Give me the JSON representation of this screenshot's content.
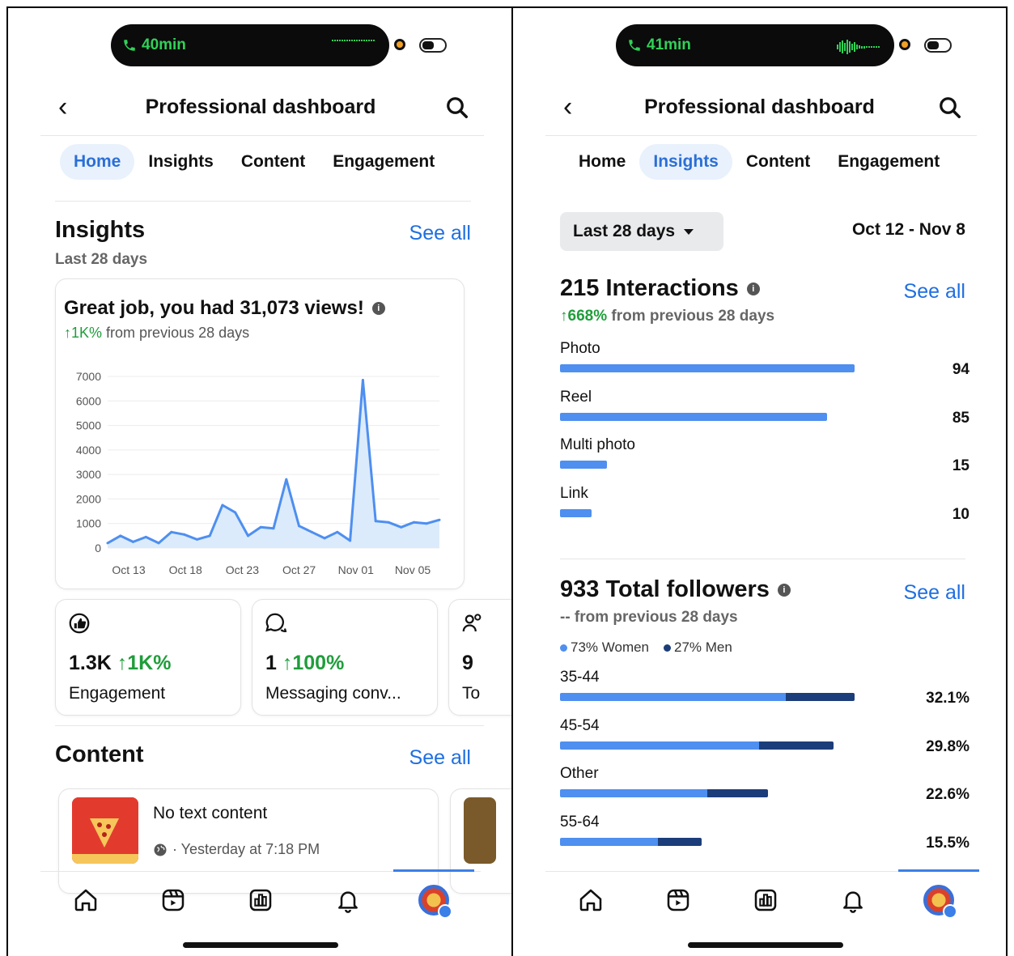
{
  "left": {
    "status": {
      "call_time": "40min"
    },
    "header": {
      "title": "Professional dashboard"
    },
    "tabs": [
      {
        "label": "Home",
        "active": true
      },
      {
        "label": "Insights",
        "active": false
      },
      {
        "label": "Content",
        "active": false
      },
      {
        "label": "Engagement",
        "active": false
      }
    ],
    "insights": {
      "title": "Insights",
      "see_all": "See all",
      "period": "Last 28 days",
      "views_headline": "Great job, you had 31,073 views!",
      "growth_value": "↑1K%",
      "growth_text": "from previous 28 days"
    },
    "chart_data": {
      "type": "area",
      "x_ticks": [
        "Oct 13",
        "Oct 18",
        "Oct 23",
        "Oct 27",
        "Nov 01",
        "Nov 05"
      ],
      "y_ticks": [
        "7000",
        "6000",
        "5000",
        "4000",
        "3000",
        "2000",
        "1000",
        "0"
      ],
      "ylim": [
        0,
        7000
      ],
      "values": [
        200,
        500,
        250,
        450,
        200,
        650,
        550,
        350,
        500,
        1750,
        1450,
        500,
        850,
        800,
        2800,
        900,
        650,
        400,
        650,
        300,
        6850,
        1100,
        1050,
        850,
        1050,
        1000,
        1150
      ],
      "color": "#4e8ff0"
    },
    "stats": [
      {
        "value": "1.3K",
        "change": "↑1K%",
        "label": "Engagement",
        "icon": "like-icon"
      },
      {
        "value": "1",
        "change": "↑100%",
        "label": "Messaging conv...",
        "icon": "message-icon"
      },
      {
        "value": "9",
        "change": "",
        "label": "To",
        "icon": "followers-icon"
      }
    ],
    "content": {
      "title": "Content",
      "see_all": "See all",
      "post_title": "No text content",
      "post_meta": "· Yesterday at 7:18 PM"
    }
  },
  "right": {
    "status": {
      "call_time": "41min"
    },
    "header": {
      "title": "Professional dashboard"
    },
    "tabs": [
      {
        "label": "Home",
        "active": false
      },
      {
        "label": "Insights",
        "active": true
      },
      {
        "label": "Content",
        "active": false
      },
      {
        "label": "Engagement",
        "active": false
      }
    ],
    "range_label": "Last 28 days",
    "date_range": "Oct 12 - Nov 8",
    "interactions": {
      "title": "215 Interactions",
      "see_all": "See all",
      "growth_value": "↑668%",
      "growth_text": "from previous 28 days",
      "rows": [
        {
          "label": "Photo",
          "value": "94",
          "fraction": 0.72
        },
        {
          "label": "Reel",
          "value": "85",
          "fraction": 0.652
        },
        {
          "label": "Multi photo",
          "value": "15",
          "fraction": 0.115
        },
        {
          "label": "Link",
          "value": "10",
          "fraction": 0.077
        }
      ]
    },
    "followers": {
      "title": "933 Total followers",
      "see_all": "See all",
      "sub": "-- from previous 28 days",
      "women": "73% Women",
      "men": "27% Men",
      "women_color": "#4e8ff0",
      "men_color": "#1b3d7a",
      "rows": [
        {
          "label": "35-44",
          "value": "32.1%",
          "women_fraction": 0.552,
          "men_fraction": 0.168
        },
        {
          "label": "45-54",
          "value": "29.8%",
          "women_fraction": 0.487,
          "men_fraction": 0.182
        },
        {
          "label": "Other",
          "value": "22.6%",
          "women_fraction": 0.36,
          "men_fraction": 0.148
        },
        {
          "label": "55-64",
          "value": "15.5%",
          "women_fraction": 0.24,
          "men_fraction": 0.106
        }
      ]
    }
  }
}
